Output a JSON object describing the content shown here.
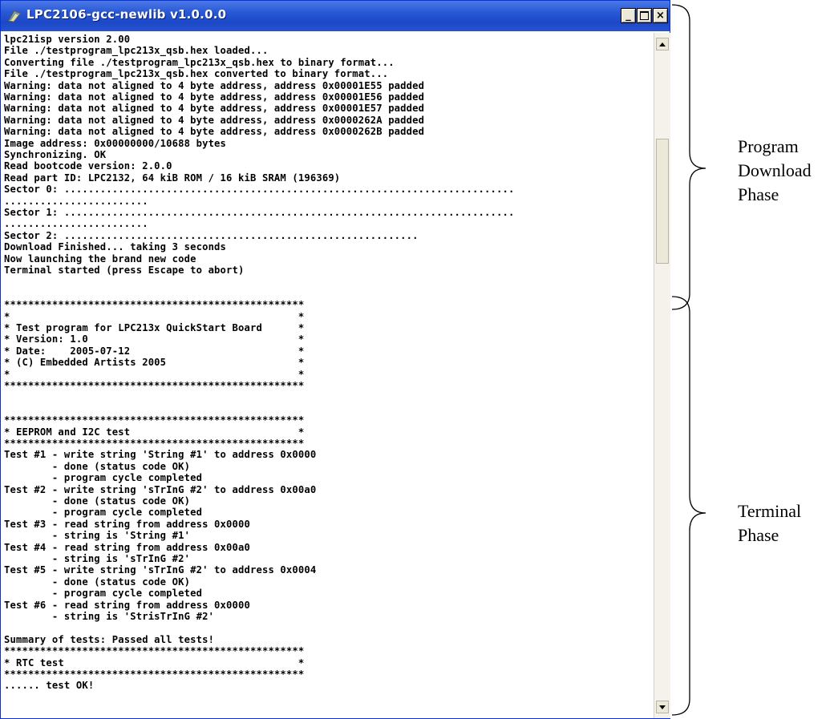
{
  "window": {
    "title": "LPC2106-gcc-newlib v1.0.0.0",
    "title_bar_color": "#1c48c8",
    "minimize_label": "_",
    "close_label": "×"
  },
  "console": {
    "lines": [
      "lpc21isp version 2.00",
      "File ./testprogram_lpc213x_qsb.hex loaded...",
      "Converting file ./testprogram_lpc213x_qsb.hex to binary format...",
      "File ./testprogram_lpc213x_qsb.hex converted to binary format...",
      "Warning: data not aligned to 4 byte address, address 0x00001E55 padded",
      "Warning: data not aligned to 4 byte address, address 0x00001E56 padded",
      "Warning: data not aligned to 4 byte address, address 0x00001E57 padded",
      "Warning: data not aligned to 4 byte address, address 0x0000262A padded",
      "Warning: data not aligned to 4 byte address, address 0x0000262B padded",
      "Image address: 0x00000000/10688 bytes",
      "Synchronizing. OK",
      "Read bootcode version: 2.0.0",
      "Read part ID: LPC2132, 64 kiB ROM / 16 kiB SRAM (196369)",
      "Sector 0: ...........................................................................",
      "........................",
      "Sector 1: ...........................................................................",
      "........................",
      "Sector 2: ...........................................................",
      "Download Finished... taking 3 seconds",
      "Now launching the brand new code",
      "Terminal started (press Escape to abort)",
      "",
      "",
      "**************************************************",
      "*                                                *",
      "* Test program for LPC213x QuickStart Board      *",
      "* Version: 1.0                                   *",
      "* Date:    2005-07-12                            *",
      "* (C) Embedded Artists 2005                      *",
      "*                                                *",
      "**************************************************",
      "",
      "",
      "**************************************************",
      "* EEPROM and I2C test                            *",
      "**************************************************",
      "Test #1 - write string 'String #1' to address 0x0000",
      "        - done (status code OK)",
      "        - program cycle completed",
      "Test #2 - write string 'sTrInG #2' to address 0x00a0",
      "        - done (status code OK)",
      "        - program cycle completed",
      "Test #3 - read string from address 0x0000",
      "        - string is 'String #1'",
      "Test #4 - read string from address 0x00a0",
      "        - string is 'sTrInG #2'",
      "Test #5 - write string 'sTrInG #2' to address 0x0004",
      "        - done (status code OK)",
      "        - program cycle completed",
      "Test #6 - read string from address 0x0000",
      "        - string is 'StrisTrInG #2'",
      "",
      "Summary of tests: Passed all tests!",
      "**************************************************",
      "* RTC test                                       *",
      "**************************************************",
      "...... test OK!"
    ]
  },
  "annotations": {
    "program_download": [
      "Program",
      "Download",
      "Phase"
    ],
    "terminal": [
      "Terminal",
      "Phase"
    ]
  }
}
